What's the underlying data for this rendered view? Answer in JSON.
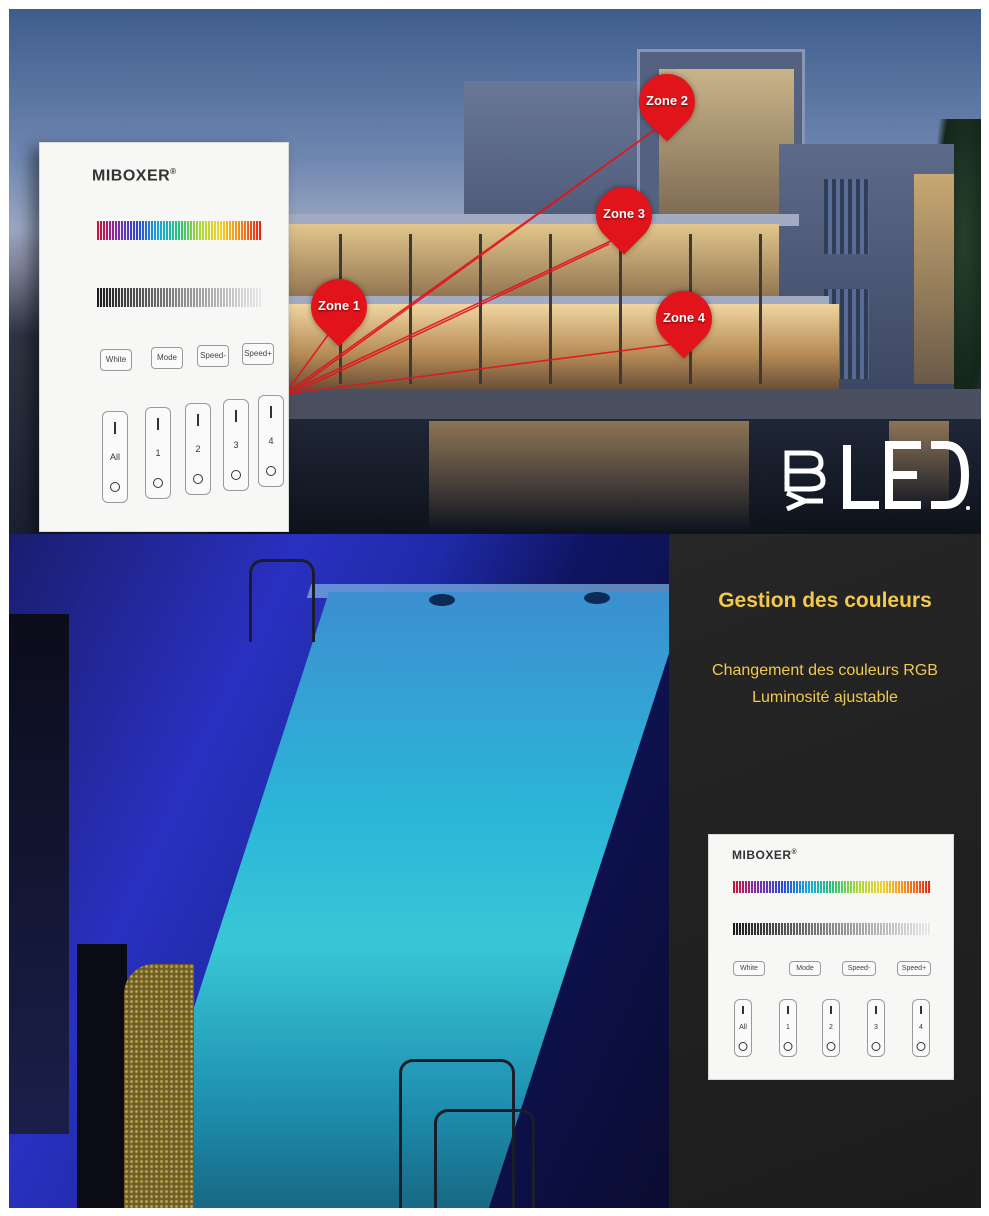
{
  "top_scene": {
    "zones": [
      {
        "label": "Zone 1"
      },
      {
        "label": "Zone 2"
      },
      {
        "label": "Zone 3"
      },
      {
        "label": "Zone 4"
      }
    ],
    "beam_color": "#e2141b",
    "logo": {
      "prefix": "BY",
      "name": "LED"
    }
  },
  "controller": {
    "brand": "MIBOXER",
    "registered": "®",
    "mode_buttons": [
      "White",
      "Mode",
      "Speed-",
      "Speed+"
    ],
    "zone_buttons": [
      "All",
      "1",
      "2",
      "3",
      "4"
    ]
  },
  "feature_panel": {
    "title": "Gestion des couleurs",
    "lines": [
      "Changement des couleurs RGB",
      "Luminosité ajustable"
    ],
    "accent_color": "#f2c94c"
  }
}
